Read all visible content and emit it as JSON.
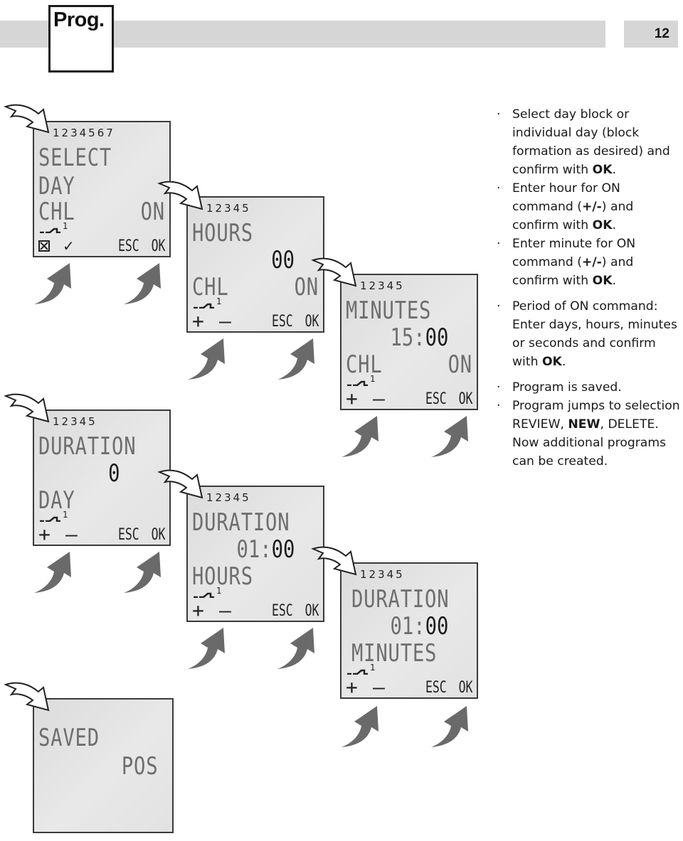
{
  "header": {
    "section_tab": "Prog.",
    "page_number": "12"
  },
  "screens": [
    {
      "id": "select-day",
      "days": "1234567",
      "line1": "SELECT",
      "line2": "DAY",
      "line3_left": "CHL",
      "line3_right": "ON",
      "channel": "1",
      "left_buttons": [
        "☒",
        "✓"
      ],
      "esc": "ESC",
      "ok": "OK"
    },
    {
      "id": "hours",
      "days": "12345",
      "line1": "HOURS",
      "value_dim": "",
      "value_bold": "00",
      "line3_left": "CHL",
      "line3_right": "ON",
      "channel": "1",
      "plus": "+",
      "minus": "—",
      "esc": "ESC",
      "ok": "OK"
    },
    {
      "id": "minutes",
      "days": "12345",
      "line1": "MINUTES",
      "value_dim": "15:",
      "value_bold": "00",
      "line3_left": "CHL",
      "line3_right": "ON",
      "channel": "1",
      "plus": "+",
      "minus": "—",
      "esc": "ESC",
      "ok": "OK"
    },
    {
      "id": "duration-day",
      "days": "12345",
      "line1": "DURATION",
      "value_dim": "",
      "value_bold": "0",
      "line3_left": "DAY",
      "channel": "1",
      "plus": "+",
      "minus": "—",
      "esc": "ESC",
      "ok": "OK"
    },
    {
      "id": "duration-hours",
      "days": "12345",
      "line1": "DURATION",
      "value_dim": "01:",
      "value_bold": "00",
      "line3_left": "HOURS",
      "channel": "1",
      "plus": "+",
      "minus": "—",
      "esc": "ESC",
      "ok": "OK"
    },
    {
      "id": "duration-minutes",
      "days": "12345",
      "line1": "DURATION",
      "value_dim": "01:",
      "value_bold": "00",
      "line3_left": "MINUTES",
      "channel": "1",
      "plus": "+",
      "minus": "—",
      "esc": "ESC",
      "ok": "OK"
    },
    {
      "id": "saved",
      "line1": "SAVED",
      "line2_right": "POS"
    }
  ],
  "instructions": [
    {
      "parts": [
        "Select day block or individual day (block formation as desired) and confirm with ",
        "OK",
        "."
      ]
    },
    {
      "parts": [
        "Enter hour for ON command (",
        "+/-",
        ") and confirm with ",
        "OK",
        "."
      ]
    },
    {
      "parts": [
        "Enter minute for ON command (",
        "+/-",
        ") and confirm with ",
        "OK",
        "."
      ]
    },
    {
      "parts": [
        "Period of ON command: Enter days, hours, minutes or seconds and confirm with ",
        "OK",
        "."
      ]
    },
    {
      "parts": [
        "Program is saved."
      ]
    },
    {
      "parts": [
        "Program jumps to selection REVIEW, ",
        "NEW",
        ", DELETE. Now additional programs can be created."
      ]
    }
  ]
}
